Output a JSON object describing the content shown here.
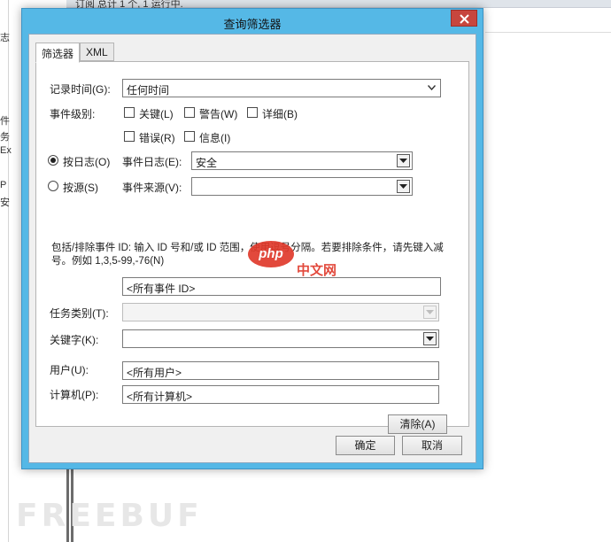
{
  "background": {
    "top_text": "订阅    总计 1 个, 1 运行中.",
    "left_fragments": [
      "志",
      "件",
      "务",
      "Ex",
      "P",
      "安"
    ],
    "watermark": "FREEBUF"
  },
  "dialog": {
    "title": "查询筛选器",
    "tabs": [
      {
        "label": "筛选器",
        "active": true
      },
      {
        "label": "XML",
        "active": false
      }
    ],
    "logged": {
      "label": "记录时间(G):",
      "value": "任何时间"
    },
    "event_level": {
      "label": "事件级别:",
      "options": [
        {
          "label": "关键(L)",
          "checked": false
        },
        {
          "label": "警告(W)",
          "checked": false
        },
        {
          "label": "详细(B)",
          "checked": false
        },
        {
          "label": "错误(R)",
          "checked": false
        },
        {
          "label": "信息(I)",
          "checked": false
        }
      ]
    },
    "by_log": {
      "label": "按日志(O)",
      "checked": true,
      "field_label": "事件日志(E):",
      "value": "安全"
    },
    "by_source": {
      "label": "按源(S)",
      "checked": false,
      "field_label": "事件来源(V):",
      "value": ""
    },
    "help_text": "包括/排除事件 ID: 输入 ID 号和/或 ID 范围，使用逗号分隔。若要排除条件，请先键入减号。例如 1,3,5-99,-76(N)",
    "event_ids": {
      "value": "<所有事件 ID>"
    },
    "task_category": {
      "label": "任务类别(T):",
      "value": "",
      "disabled": true
    },
    "keywords": {
      "label": "关键字(K):",
      "value": ""
    },
    "user": {
      "label": "用户(U):",
      "value": "<所有用户>"
    },
    "computer": {
      "label": "计算机(P):",
      "value": "<所有计算机>"
    },
    "clear_label": "清除(A)",
    "ok_label": "确定",
    "cancel_label": "取消"
  },
  "overlay": {
    "logo_text": "php",
    "site_text": "中文网",
    "logo_color": "#e03a2c"
  },
  "colors": {
    "titlebar": "#55b8e6",
    "close_button": "#c7463e",
    "client_bg": "#f0f0f0"
  }
}
